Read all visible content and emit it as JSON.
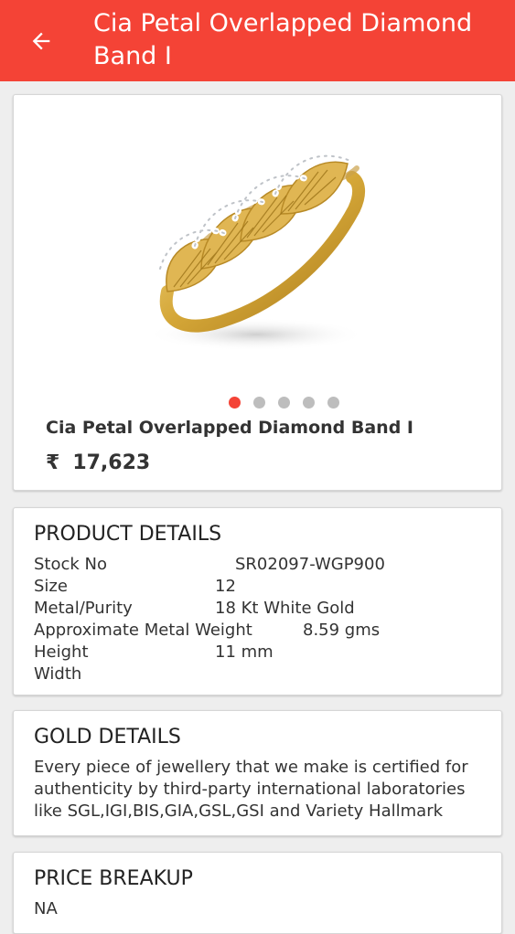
{
  "appbar": {
    "title": "Cia Petal Overlapped Diamond Band I",
    "back_icon": "arrow-left-icon",
    "color": "#f44336"
  },
  "product": {
    "image": "diamond-ring-image",
    "carousel": {
      "total": 5,
      "active_index": 0
    },
    "name": "Cia Petal Overlapped Diamond Band I",
    "currency_symbol": "₹",
    "price": "17,623"
  },
  "product_details": {
    "title": "PRODUCT DETAILS",
    "rows": [
      {
        "label": "Stock No",
        "value": "SR02097-WGP900"
      },
      {
        "label": "Size",
        "value": "12"
      },
      {
        "label": "Metal/Purity",
        "value": "18 Kt White Gold"
      },
      {
        "label": "Approximate Metal Weight",
        "value": "8.59 gms"
      },
      {
        "label": "Height",
        "value": "11 mm"
      },
      {
        "label": "Width",
        "value": ""
      }
    ]
  },
  "gold_details": {
    "title": "GOLD DETAILS",
    "text": "Every piece of jewellery that we make is certified for authenticity by third-party international laboratories like SGL,IGI,BIS,GIA,GSL,GSI and Variety Hallmark"
  },
  "price_breakup": {
    "title": "PRICE BREAKUP",
    "text": "NA"
  }
}
